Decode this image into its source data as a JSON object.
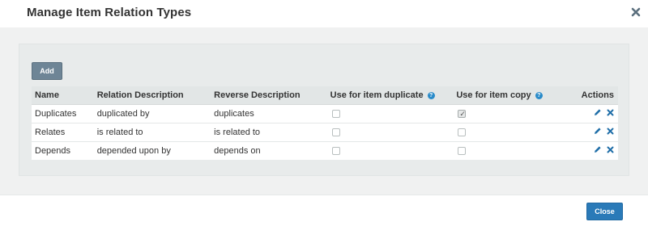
{
  "modal": {
    "title": "Manage Item Relation Types",
    "close_icon": "close-icon"
  },
  "toolbar": {
    "add_label": "Add"
  },
  "table": {
    "headers": {
      "name": "Name",
      "relation_description": "Relation Description",
      "reverse_description": "Reverse Description",
      "use_for_item_duplicate": "Use for item duplicate",
      "use_for_item_copy": "Use for item copy",
      "actions": "Actions"
    },
    "help_icon": "help-icon",
    "rows": [
      {
        "name": "Duplicates",
        "relation_description": "duplicated by",
        "reverse_description": "duplicates",
        "use_for_item_duplicate": false,
        "use_for_item_copy": true
      },
      {
        "name": "Relates",
        "relation_description": "is related to",
        "reverse_description": "is related to",
        "use_for_item_duplicate": false,
        "use_for_item_copy": false
      },
      {
        "name": "Depends",
        "relation_description": "depended upon by",
        "reverse_description": "depends on",
        "use_for_item_duplicate": false,
        "use_for_item_copy": false
      }
    ]
  },
  "footer": {
    "close_label": "Close"
  },
  "colors": {
    "accent": "#2a7ab8",
    "add_button": "#6e8596",
    "help_icon": "#2a8bc9",
    "action_icon": "#1f6ea8"
  }
}
